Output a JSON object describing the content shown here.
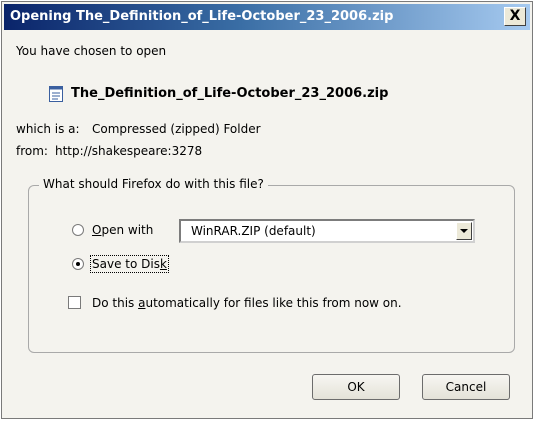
{
  "window": {
    "title": "Opening The_Definition_of_Life-October_23_2006.zip",
    "close_label": "X"
  },
  "info": {
    "intro": "You have chosen to open",
    "filename": "The_Definition_of_Life-October_23_2006.zip",
    "type_label": "which is a:",
    "type_value": "Compressed (zipped) Folder",
    "from_label": "from:",
    "from_value": "http://shakespeare:3278"
  },
  "group": {
    "legend": "What should Firefox do with this file?"
  },
  "options": {
    "open_with": {
      "label_pre": "",
      "label_key": "O",
      "label_post": "pen with",
      "selected": false
    },
    "app_select": {
      "value": "WinRAR.ZIP (default)"
    },
    "save_to_disk": {
      "label_pre": "Save to Dis",
      "label_key": "k",
      "label_post": "",
      "selected": true
    },
    "auto": {
      "label_pre": "Do this ",
      "label_key": "a",
      "label_post": "utomatically for files like this from now on.",
      "checked": false
    }
  },
  "buttons": {
    "ok": "OK",
    "cancel": "Cancel"
  },
  "icons": {
    "file": "zip-file-icon"
  }
}
